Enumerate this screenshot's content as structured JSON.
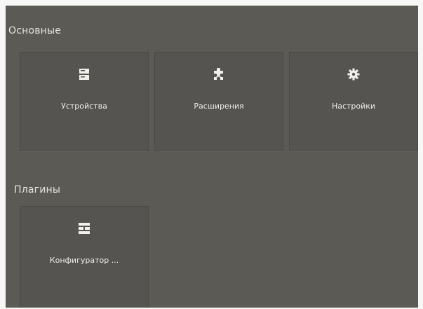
{
  "sections": [
    {
      "title": "Основные",
      "cards": [
        {
          "label": "Устройства",
          "icon": "server-icon"
        },
        {
          "label": "Расширения",
          "icon": "puzzle-icon"
        },
        {
          "label": "Настройки",
          "icon": "gear-icon"
        }
      ]
    },
    {
      "title": "Плагины",
      "cards": [
        {
          "label": "Конфигуратор ...",
          "icon": "configurator-icon"
        }
      ]
    }
  ],
  "colors": {
    "panel_background": "#5b5a55",
    "card_background": "#555450",
    "text": "#efeee9"
  }
}
